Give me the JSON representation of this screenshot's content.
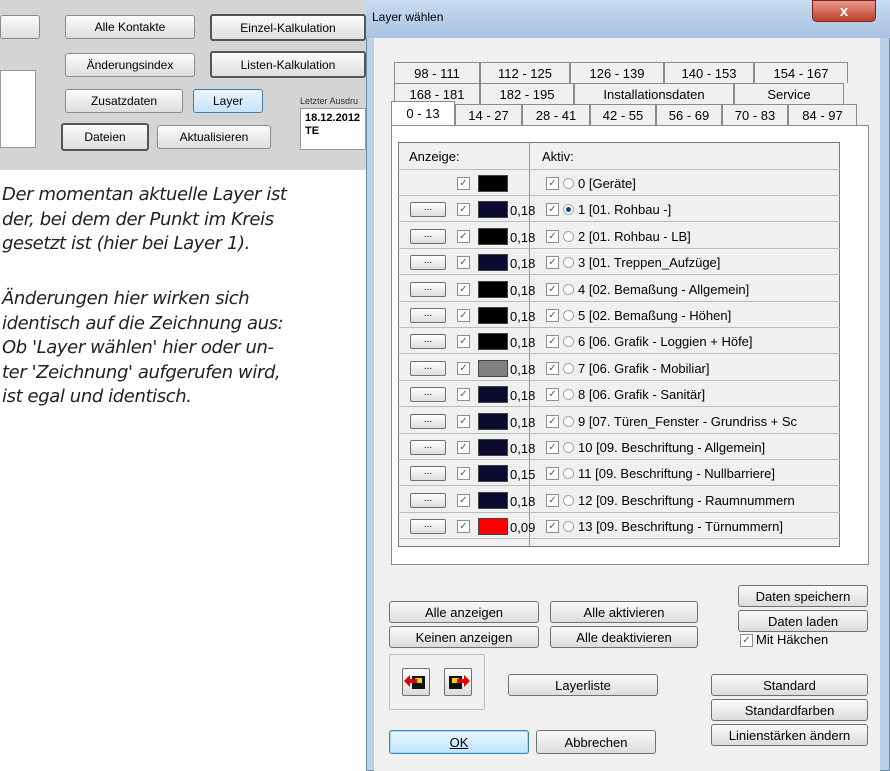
{
  "left_app": {
    "buttons": {
      "alle_kontakte": "Alle Kontakte",
      "einzel_kalkulation": "Einzel-Kalkulation",
      "aenderungsindex": "Änderungsindex",
      "listen_kalkulation": "Listen-Kalkulation",
      "zusatzdaten": "Zusatzdaten",
      "layer": "Layer",
      "dateien": "Dateien",
      "aktualisieren": "Aktualisieren"
    },
    "letzter_label": "Letzter Ausdru",
    "info_date": "18.12.2012",
    "info_code": "TE"
  },
  "caption": {
    "para1": "Der momentan aktuelle Layer ist\nder, bei dem der Punkt im Kreis\ngesetzt ist (hier bei Layer 1).",
    "para2": "Änderungen hier wirken sich\nidentisch auf die Zeichnung aus:\nOb 'Layer wählen' hier oder un-\nter 'Zeichnung' aufgerufen wird,\nist egal und identisch."
  },
  "dialog": {
    "title": "Layer wählen",
    "close": "x",
    "tabs_row1": [
      "98 - 111",
      "112 - 125",
      "126 - 139",
      "140 - 153",
      "154 - 167"
    ],
    "tabs_row2": [
      "168 - 181",
      "182 - 195",
      "Installationsdaten",
      "Service"
    ],
    "tabs_row3": [
      "0 - 13",
      "14 - 27",
      "28 - 41",
      "42 - 55",
      "56 - 69",
      "70 - 83",
      "84 - 97"
    ],
    "col_anzeige": "Anzeige:",
    "col_aktiv": "Aktiv:",
    "row_button": "...",
    "check": "✓",
    "layers": [
      {
        "name": "0 [Geräte]",
        "thickness": "",
        "color": "#000000",
        "active": false,
        "has_button": false
      },
      {
        "name": "1 [01.   Rohbau -]",
        "thickness": "0,18",
        "color": "#0a0a2e",
        "active": true,
        "has_button": true
      },
      {
        "name": "2 [01.   Rohbau - LB]",
        "thickness": "0,18",
        "color": "#000000",
        "active": false,
        "has_button": true
      },
      {
        "name": "3 [01.   Treppen_Aufzüge]",
        "thickness": "0,18",
        "color": "#0a0a2e",
        "active": false,
        "has_button": true
      },
      {
        "name": "4 [02.   Bemaßung - Allgemein]",
        "thickness": "0,18",
        "color": "#000000",
        "active": false,
        "has_button": true
      },
      {
        "name": "5 [02.   Bemaßung - Höhen]",
        "thickness": "0,18",
        "color": "#000000",
        "active": false,
        "has_button": true
      },
      {
        "name": "6 [06.   Grafik - Loggien + Höfe]",
        "thickness": "0,18",
        "color": "#000000",
        "active": false,
        "has_button": true
      },
      {
        "name": "7 [06.   Grafik - Mobiliar]",
        "thickness": "0,18",
        "color": "#808080",
        "active": false,
        "has_button": true
      },
      {
        "name": "8 [06.   Grafik - Sanitär]",
        "thickness": "0,18",
        "color": "#0a0a2e",
        "active": false,
        "has_button": true
      },
      {
        "name": "9 [07.   Türen_Fenster - Grundriss + Sc",
        "thickness": "0,18",
        "color": "#0a0a2e",
        "active": false,
        "has_button": true
      },
      {
        "name": "10 [09.   Beschriftung - Allgemein]",
        "thickness": "0,18",
        "color": "#0a0a2e",
        "active": false,
        "has_button": true
      },
      {
        "name": "11 [09.   Beschriftung - Nullbarriere]",
        "thickness": "0,15",
        "color": "#0a0a2e",
        "active": false,
        "has_button": true
      },
      {
        "name": "12 [09.   Beschriftung - Raumnummern",
        "thickness": "0,18",
        "color": "#0a0a2e",
        "active": false,
        "has_button": true
      },
      {
        "name": "13 [09. Beschriftung - Türnummern]",
        "thickness": "0,09",
        "color": "#ff0000",
        "active": false,
        "has_button": true
      }
    ],
    "buttons": {
      "alle_anzeigen": "Alle anzeigen",
      "keinen_anzeigen": "Keinen anzeigen",
      "alle_aktivieren": "Alle aktivieren",
      "alle_deaktivieren": "Alle deaktivieren",
      "daten_speichern": "Daten speichern",
      "daten_laden": "Daten laden",
      "mit_haekchen": "Mit Häkchen",
      "layerliste": "Layerliste",
      "standard": "Standard",
      "standardfarben": "Standardfarben",
      "linienstaerken": "Linienstärken ändern",
      "ok": "OK",
      "abbrechen": "Abbrechen"
    }
  }
}
